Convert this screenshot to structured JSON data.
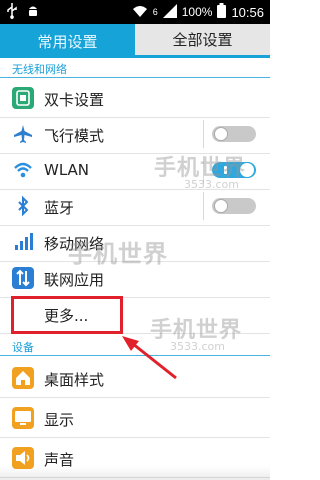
{
  "status_bar": {
    "time": "10:56",
    "battery_percent": "100%",
    "signal_label": "6",
    "icons": [
      "usb-icon",
      "android-debug-icon",
      "wifi-icon",
      "signal-icon",
      "battery-icon"
    ]
  },
  "tabs": [
    {
      "label": "常用设置",
      "active": false
    },
    {
      "label": "全部设置",
      "active": true
    }
  ],
  "sections": {
    "wireless": {
      "title": "无线和网络",
      "items": [
        {
          "label": "双卡设置",
          "icon": "dual-sim-icon",
          "color": "#2aa876"
        },
        {
          "label": "飞行模式",
          "icon": "airplane-icon",
          "color": "#2f7fcf",
          "toggle": "off"
        },
        {
          "label": "WLAN",
          "icon": "wifi-icon",
          "color": "#2a8fe0",
          "toggle": "on"
        },
        {
          "label": "蓝牙",
          "icon": "bluetooth-icon",
          "color": "#2a7fd4",
          "toggle": "off"
        },
        {
          "label": "移动网络",
          "icon": "signal-bars-icon",
          "color": "#2a7fd4"
        },
        {
          "label": "联网应用",
          "icon": "data-arrows-icon",
          "color": "#2a7fd4"
        },
        {
          "label": "更多..."
        }
      ]
    },
    "device": {
      "title": "设备",
      "items": [
        {
          "label": "桌面样式",
          "icon": "home-icon",
          "color": "#f2a020"
        },
        {
          "label": "显示",
          "icon": "display-icon",
          "color": "#f2a020"
        },
        {
          "label": "声音",
          "icon": "sound-icon",
          "color": "#f2a020"
        }
      ]
    }
  },
  "watermark": {
    "text": "手机世界",
    "sub": "3533.com"
  },
  "annotation": {
    "box_color": "#e0202a",
    "arrow_color": "#e0202a"
  }
}
